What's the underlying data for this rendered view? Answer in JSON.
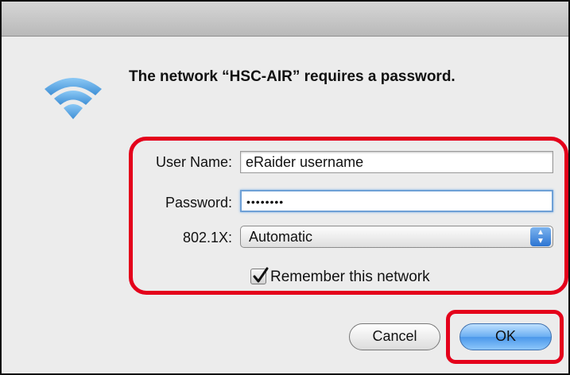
{
  "dialog": {
    "message": "The network “HSC-AIR” requires a password.",
    "icon": "wifi-icon"
  },
  "form": {
    "username": {
      "label": "User Name:",
      "value": "eRaider username"
    },
    "password": {
      "label": "Password:",
      "value": "••••••••"
    },
    "eap": {
      "label": "802.1X:",
      "selected": "Automatic"
    },
    "remember": {
      "label": "Remember this network",
      "checked": true
    }
  },
  "buttons": {
    "cancel": "Cancel",
    "ok": "OK"
  },
  "colors": {
    "highlight": "#e4001b",
    "wifi": "#5aa7e6",
    "focus": "#6ea0d6"
  }
}
